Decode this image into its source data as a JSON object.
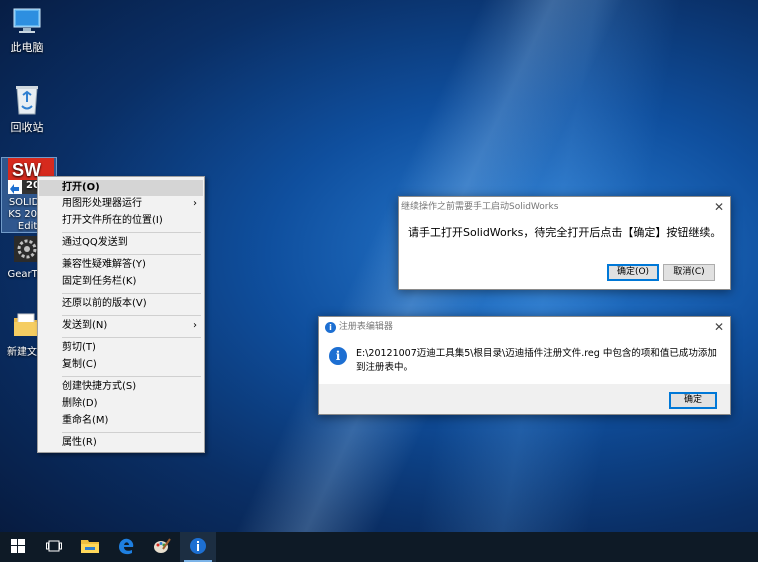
{
  "desktop": {
    "icons": [
      {
        "label": "此电脑"
      },
      {
        "label": "回收站"
      },
      {
        "label": "SOLIDW KS 2016 Editi",
        "badge": "201"
      },
      {
        "label": "GearTra"
      },
      {
        "label": "新建文件"
      }
    ]
  },
  "context_menu": {
    "items": [
      "打开(O)",
      "用图形处理器运行",
      "打开文件所在的位置(I)",
      "通过QQ发送到",
      "兼容性疑难解答(Y)",
      "固定到任务栏(K)",
      "还原以前的版本(V)",
      "发送到(N)",
      "剪切(T)",
      "复制(C)",
      "创建快捷方式(S)",
      "删除(D)",
      "重命名(M)",
      "属性(R)"
    ],
    "submenu_arrow": "›"
  },
  "dialog_solidworks": {
    "title": "继续操作之前需要手工启动SolidWorks",
    "message": "请手工打开SolidWorks，待完全打开后点击【确定】按钮继续。",
    "ok_label": "确定(O)",
    "cancel_label": "取消(C)",
    "close": "✕"
  },
  "dialog_registry": {
    "title": "注册表编辑器",
    "message": "E:\\20121007迈迪工具集5\\根目录\\迈迪插件注册文件.reg 中包含的项和值已成功添加到注册表中。",
    "ok_label": "确定",
    "close": "✕"
  },
  "taskbar": {
    "items": [
      "start-icon",
      "task-view-icon",
      "file-explorer-icon",
      "edge-icon",
      "paint-icon",
      "info-icon"
    ]
  },
  "colors": {
    "accent": "#0078d7",
    "taskbar": "#0e1a26",
    "solidworks_red": "#d62a1e"
  }
}
